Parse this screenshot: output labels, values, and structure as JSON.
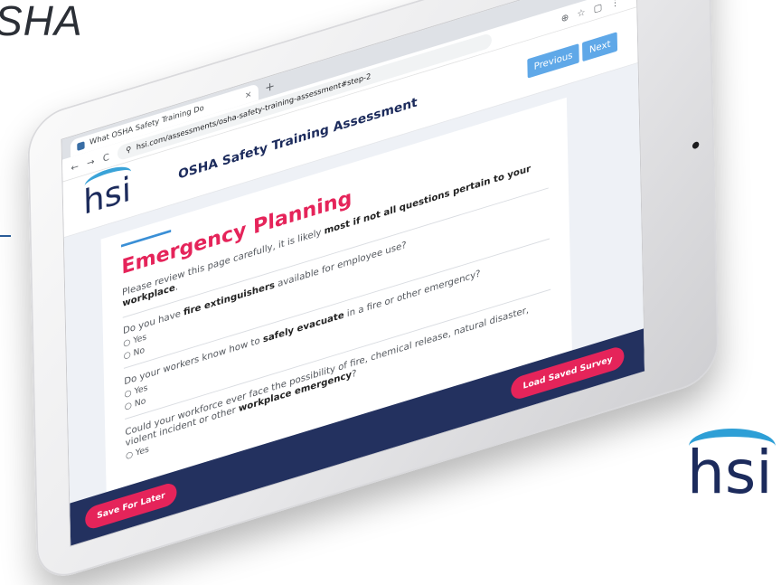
{
  "background": {
    "title": "SHA",
    "brand_logo": "hsi"
  },
  "browser": {
    "tab_title": "What OSHA Safety Training Do",
    "tab_close": "×",
    "new_tab": "+",
    "url": "hsi.com/assessments/osha-safety-training-assessment#step-2",
    "nav_back": "←",
    "nav_forward": "→",
    "reload": "C"
  },
  "site": {
    "logo": "hsi",
    "title": "OSHA Safety Training Assessment",
    "previous_label": "Previous",
    "next_label": "Next"
  },
  "form": {
    "section_title": "Emergency Planning",
    "intro_pre": "Please review this page carefully, it is likely ",
    "intro_bold": "most if not all questions pertain to your workplace",
    "intro_post": ".",
    "questions": [
      {
        "pre": "Do you have ",
        "bold": "fire extinguishers",
        "post": " available for employee use?",
        "options": [
          "Yes",
          "No"
        ]
      },
      {
        "pre": "Do your workers know how to ",
        "bold": "safely evacuate",
        "post": " in a fire or other emergency?",
        "options": [
          "Yes",
          "No"
        ]
      },
      {
        "pre": "Could your workforce ever face the possibility of fire, chemical release, natural disaster, violent incident or other ",
        "bold": "workplace emergency",
        "post": "?",
        "options": [
          "Yes"
        ]
      }
    ],
    "save_label": "Save For Later",
    "load_label": "Load Saved Survey"
  },
  "colors": {
    "accent_pink": "#e5245a",
    "navy": "#23315f",
    "button_blue": "#5fa8e8"
  }
}
